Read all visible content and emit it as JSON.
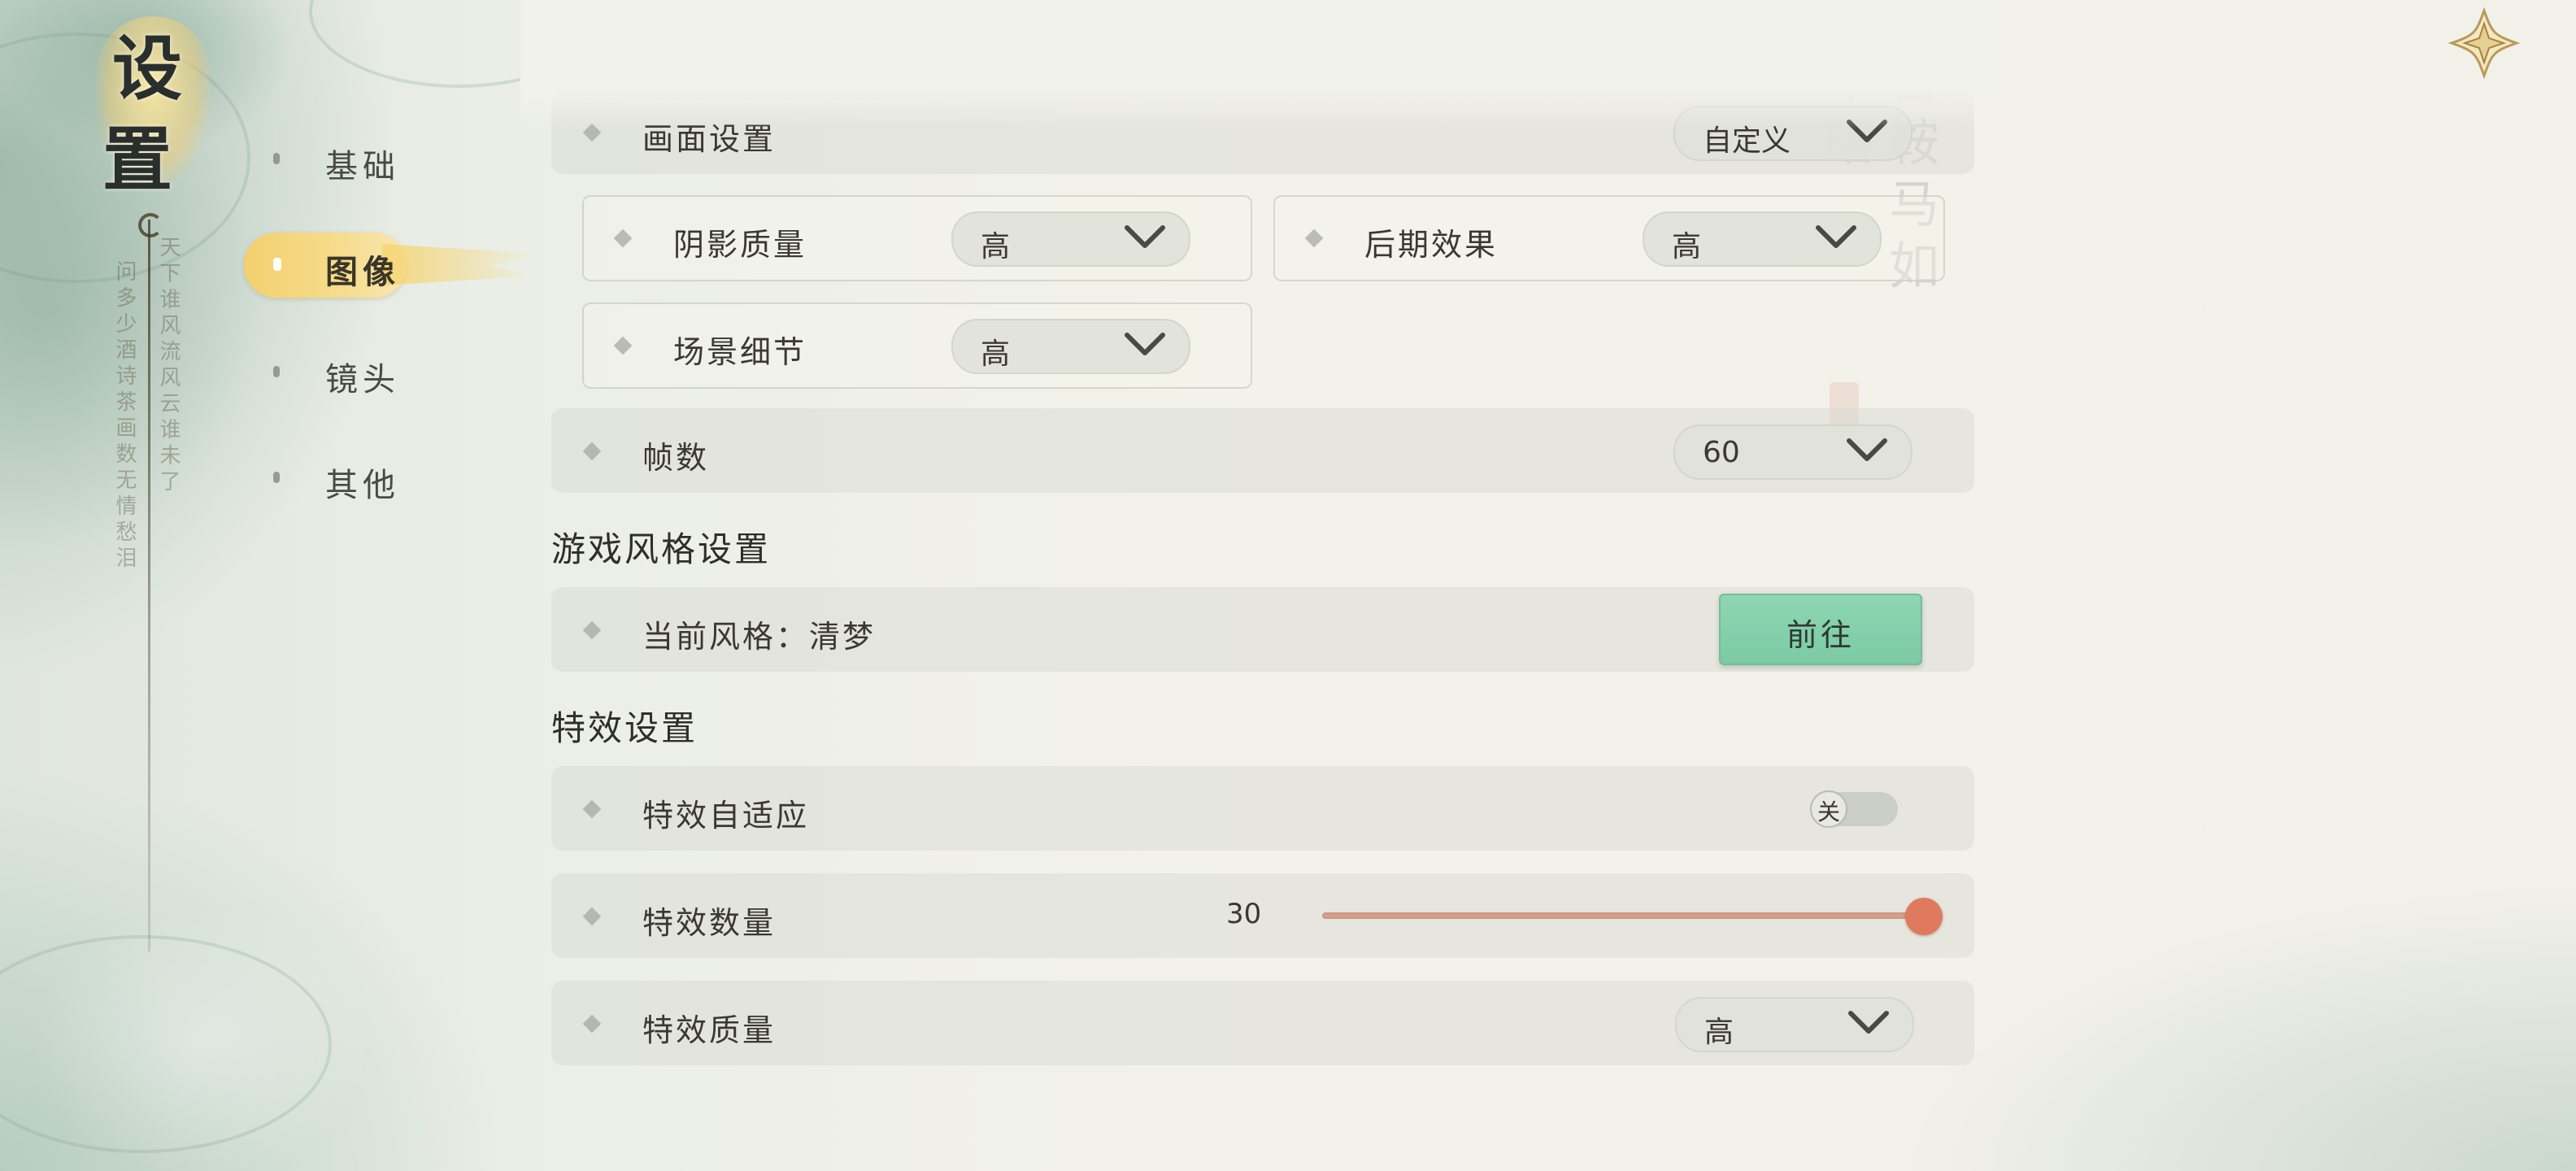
{
  "title": {
    "char1": "设",
    "char2": "置"
  },
  "decor": {
    "poem_left": "问多少酒诗茶画数无情愁泪",
    "poem_left2": "天下谁风流风云谁未了",
    "right_calligraphy": "白首鞍马如何年暗"
  },
  "nav": {
    "items": [
      {
        "label": "基础",
        "active": false
      },
      {
        "label": "图像",
        "active": true
      },
      {
        "label": "镜头",
        "active": false
      },
      {
        "label": "其他",
        "active": false
      }
    ]
  },
  "graphics": {
    "header_row": {
      "label": "画面设置",
      "value": "自定义"
    },
    "shadow": {
      "label": "阴影质量",
      "value": "高"
    },
    "post": {
      "label": "后期效果",
      "value": "高"
    },
    "scene": {
      "label": "场景细节",
      "value": "高"
    },
    "fps": {
      "label": "帧数",
      "value": "60"
    }
  },
  "style_section": {
    "title": "游戏风格设置",
    "current": "当前风格：清梦",
    "button": "前往"
  },
  "effects_section": {
    "title": "特效设置",
    "adaptive": {
      "label": "特效自适应",
      "toggle_text": "关",
      "on": false
    },
    "count": {
      "label": "特效数量",
      "value": "30",
      "fraction": 1.0
    },
    "quality": {
      "label": "特效质量",
      "value": "高"
    }
  },
  "colors": {
    "accent_gold": "#f3d06f",
    "button_green": "#8fd6b3",
    "slider_orange": "#e07a5f"
  },
  "icons": {
    "close": "close-flower-icon",
    "dropdown": "chevron-down-icon",
    "bullet": "diamond-bullet-icon"
  }
}
